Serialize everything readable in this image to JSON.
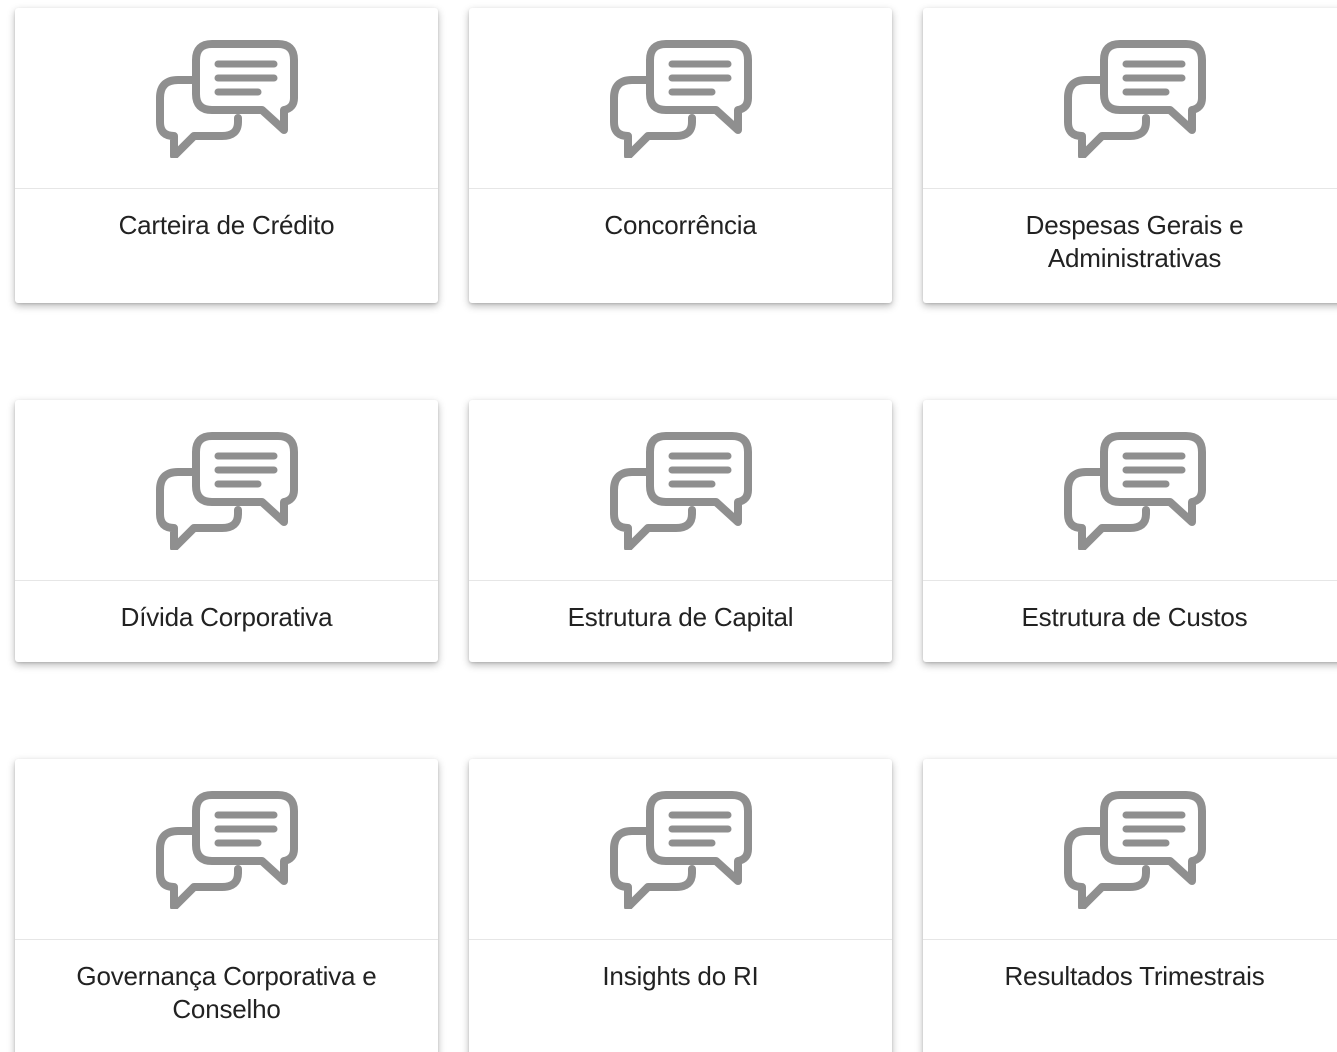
{
  "cards": [
    {
      "title": "Carteira de Crédito",
      "icon": "chat-bubbles-icon"
    },
    {
      "title": "Concorrência",
      "icon": "chat-bubbles-icon"
    },
    {
      "title": "Despesas Gerais e Administrativas",
      "icon": "chat-bubbles-icon"
    },
    {
      "title": "Dívida Corporativa",
      "icon": "chat-bubbles-icon"
    },
    {
      "title": "Estrutura de Capital",
      "icon": "chat-bubbles-icon"
    },
    {
      "title": "Estrutura de Custos",
      "icon": "chat-bubbles-icon"
    },
    {
      "title": "Governança Corporativa e Conselho",
      "icon": "chat-bubbles-icon"
    },
    {
      "title": "Insights do RI",
      "icon": "chat-bubbles-icon"
    },
    {
      "title": "Resultados Trimestrais",
      "icon": "chat-bubbles-icon"
    }
  ],
  "colors": {
    "icon": "#8f8f8f",
    "text": "#222222",
    "divider": "#e6e6e6",
    "background": "#ffffff"
  }
}
